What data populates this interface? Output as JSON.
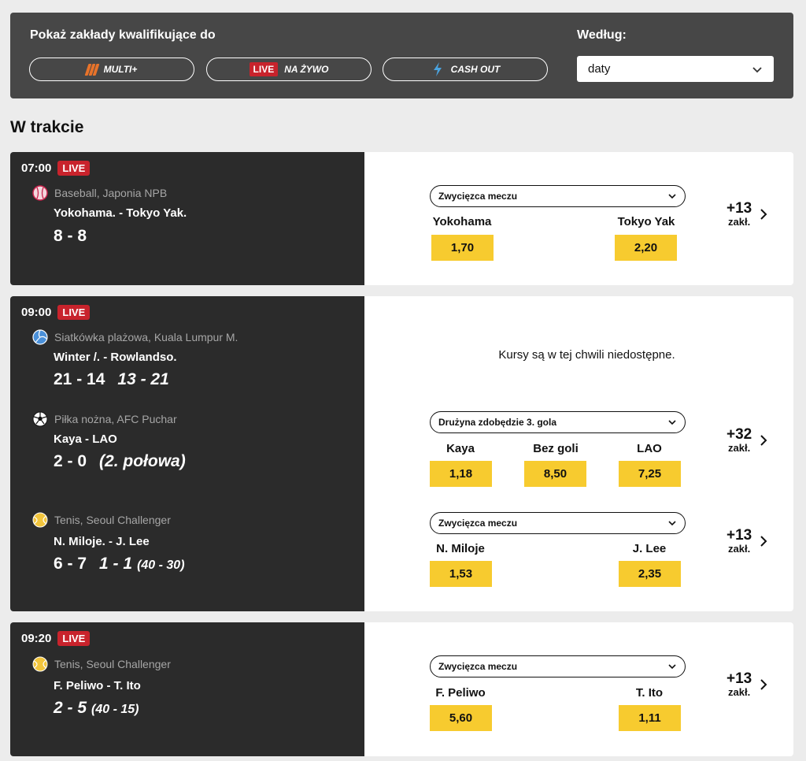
{
  "filters": {
    "title": "Pokaż zakłady kwalifikujące do",
    "multi_label": "MULTI+",
    "live_tag": "LIVE",
    "live_label": "NA ŻYWO",
    "cashout_label": "CASH OUT",
    "sort_label": "Według:",
    "sort_value": "daty",
    "colors": {
      "panel": "#474747",
      "multi": "#e8732a",
      "live": "#c8232c",
      "cashout": "#4aa3df"
    }
  },
  "section_title": "W trakcie",
  "colors": {
    "odd_button": "#f7cb2f",
    "card_dark": "#2b2b2b",
    "live_badge": "#c8232c"
  },
  "groups": [
    {
      "time": "07:00",
      "live": "LIVE",
      "events": [
        {
          "sport_icon": "baseball-icon",
          "league": "Baseball, Japonia NPB",
          "teams": "Yokohama. - Tokyo Yak.",
          "score": "8 - 8",
          "market": "Zwycięzca meczu",
          "outcomes": [
            {
              "label": "Yokohama",
              "odd": "1,70"
            },
            {
              "label": "Tokyo Yak",
              "odd": "2,20"
            }
          ],
          "more_count": "+13",
          "more_unit": "zakł."
        }
      ]
    },
    {
      "time": "09:00",
      "live": "LIVE",
      "events": [
        {
          "sport_icon": "volleyball-icon",
          "league": "Siatkówka plażowa, Kuala Lumpur M.",
          "teams": "Winter /. - Rowlandso.",
          "score": "21 - 14",
          "set_score": "13 - 21",
          "unavailable": "Kursy są w tej chwili niedostępne."
        },
        {
          "sport_icon": "soccer-ball-icon",
          "league": "Piłka nożna, AFC Puchar",
          "teams": "Kaya - LAO",
          "score": "2 - 0",
          "period": "(2. połowa)",
          "market": "Drużyna zdobędzie 3. gola",
          "outcomes": [
            {
              "label": "Kaya",
              "odd": "1,18"
            },
            {
              "label": "Bez goli",
              "odd": "8,50"
            },
            {
              "label": "LAO",
              "odd": "7,25"
            }
          ],
          "more_count": "+32",
          "more_unit": "zakł."
        },
        {
          "sport_icon": "tennis-ball-icon",
          "league": "Tenis, Seoul Challenger",
          "teams": "N. Miloje. - J. Lee",
          "score": "6 - 7",
          "set_score": "1 - 1",
          "points": "(40 - 30)",
          "market": "Zwycięzca meczu",
          "outcomes": [
            {
              "label": "N. Miloje",
              "odd": "1,53"
            },
            {
              "label": "J. Lee",
              "odd": "2,35"
            }
          ],
          "more_count": "+13",
          "more_unit": "zakł."
        }
      ]
    },
    {
      "time": "09:20",
      "live": "LIVE",
      "events": [
        {
          "sport_icon": "tennis-ball-icon",
          "league": "Tenis, Seoul Challenger",
          "teams": "F. Peliwo - T. Ito",
          "set_score": "2 - 5",
          "points": "(40 - 15)",
          "market": "Zwycięzca meczu",
          "outcomes": [
            {
              "label": "F. Peliwo",
              "odd": "5,60"
            },
            {
              "label": "T. Ito",
              "odd": "1,11"
            }
          ],
          "more_count": "+13",
          "more_unit": "zakł."
        }
      ]
    }
  ]
}
